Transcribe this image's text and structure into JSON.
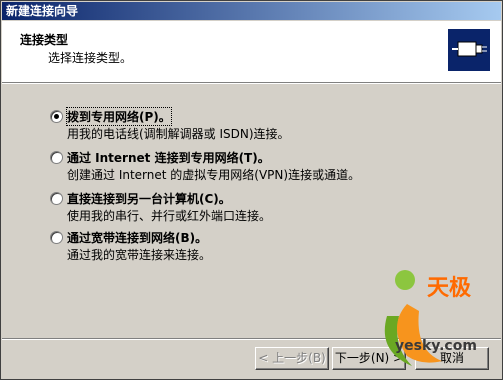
{
  "window": {
    "title": "新建连接向导"
  },
  "header": {
    "title": "连接类型",
    "subtitle": "选择连接类型。",
    "icon": "network-connection-icon"
  },
  "options": [
    {
      "label": "拨到专用网络(P)。",
      "description": "用我的电话线(调制解调器或 ISDN)连接。",
      "selected": true
    },
    {
      "label": "通过 Internet 连接到专用网络(T)。",
      "description": "创建通过 Internet 的虚拟专用网络(VPN)连接或通道。",
      "selected": false
    },
    {
      "label": "直接连接到另一台计算机(C)。",
      "description": "使用我的串行、并行或红外端口连接。",
      "selected": false
    },
    {
      "label": "通过宽带连接到网络(B)。",
      "description": "通过我的宽带连接来连接。",
      "selected": false
    }
  ],
  "buttons": {
    "back": "< 上一步(B)",
    "next": "下一步(N) >",
    "cancel": "取消"
  },
  "watermark": {
    "brand": "天极",
    "url": "yesky.com"
  }
}
